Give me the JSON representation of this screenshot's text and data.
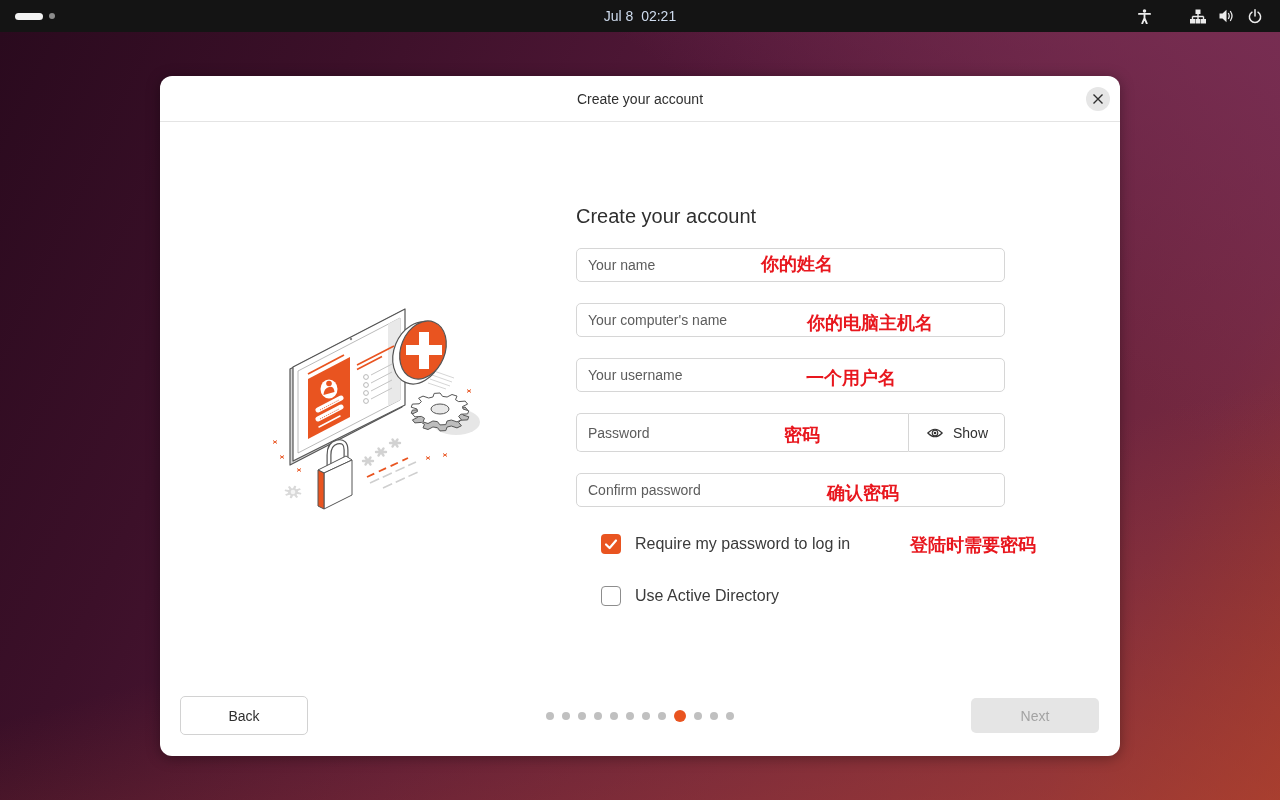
{
  "top_bar": {
    "workspaces": [
      {
        "selected": true
      },
      {
        "selected": false
      }
    ],
    "clock": "Jul 8  02:21"
  },
  "dialog": {
    "title": "Create your account",
    "heading": "Create your account",
    "fields": [
      {
        "kind": "text",
        "placeholder": "Your name",
        "annotation": "你的姓名"
      },
      {
        "kind": "text",
        "placeholder": "Your computer's name",
        "annotation": "你的电脑主机名"
      },
      {
        "kind": "text",
        "placeholder": "Your username",
        "annotation": "一个用户名"
      },
      {
        "kind": "password",
        "placeholder": "Password",
        "toggle": "Show",
        "annotation": "密码"
      },
      {
        "kind": "password",
        "placeholder": "Confirm password",
        "annotation": "确认密码"
      }
    ],
    "options": [
      {
        "label": "Require my password to log in",
        "checked": true,
        "annotation": "登陆时需要密码"
      },
      {
        "label": "Use Active Directory",
        "checked": false
      }
    ],
    "back_button": "Back",
    "steps": [
      {
        "selected": false
      },
      {
        "selected": false
      },
      {
        "selected": false
      },
      {
        "selected": false
      },
      {
        "selected": false
      },
      {
        "selected": false
      },
      {
        "selected": false
      },
      {
        "selected": false
      },
      {
        "selected": true
      },
      {
        "selected": false
      },
      {
        "selected": false
      },
      {
        "selected": false
      }
    ],
    "next_button": {
      "label": "Next",
      "disabled": true
    }
  }
}
